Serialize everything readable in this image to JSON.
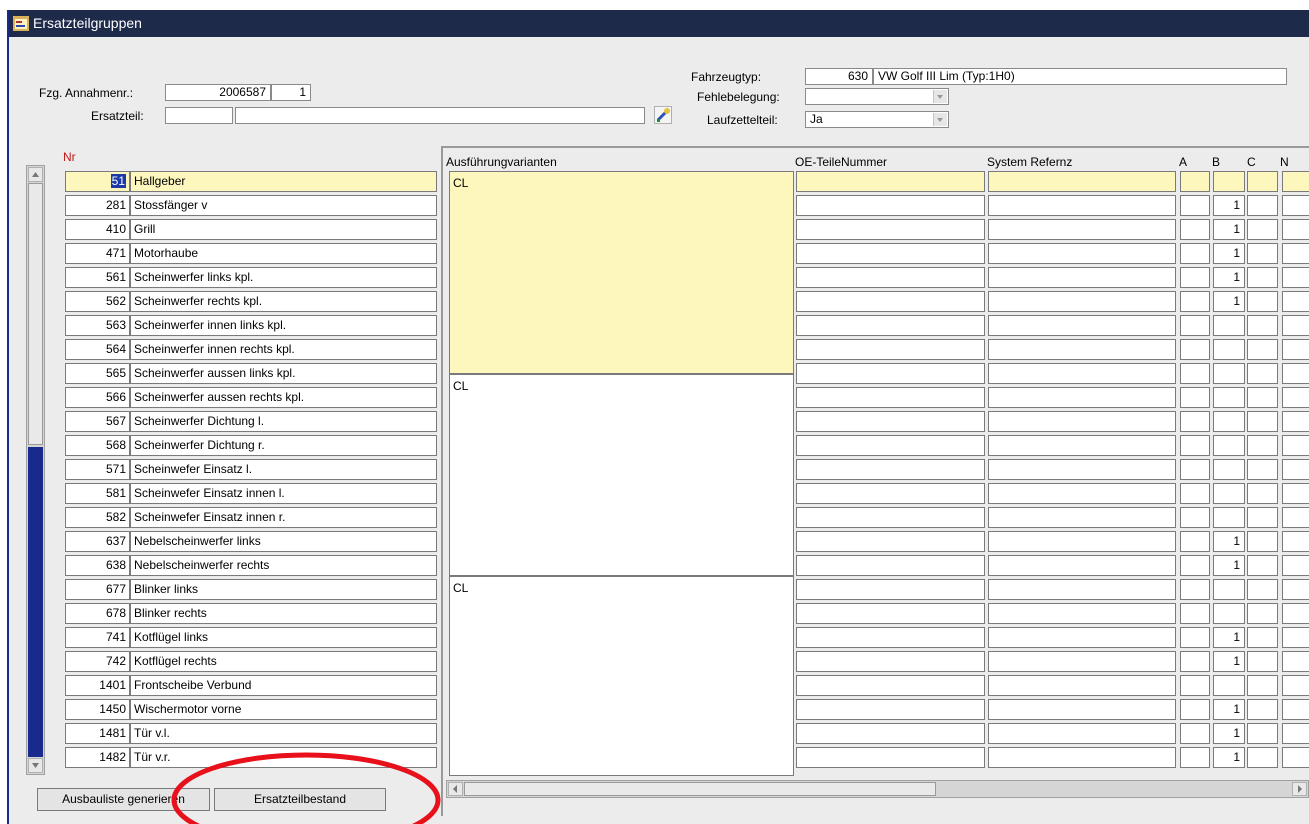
{
  "window": {
    "title": "Ersatzteilgruppen",
    "icon": "form-icon"
  },
  "form": {
    "annahme_label": "Fzg. Annahmenr.:",
    "annahme_nr": "2006587",
    "annahme_sub": "1",
    "ersatzteil_label": "Ersatzteil:",
    "ersatzteil_code": "",
    "ersatzteil_text": "",
    "fahrzeugtyp_label": "Fahrzeugtyp:",
    "fahrzeugtyp_nr": "630",
    "fahrzeugtyp_name": "VW  Golf III Lim (Typ:1H0)",
    "fehlbelegung_label": "Fehlebelegung:",
    "fehlbelegung_value": "",
    "laufzettel_label": "Laufzettelteil:",
    "laufzettel_value": "Ja"
  },
  "left_table": {
    "header": "Nr",
    "rows": [
      {
        "nr": "51",
        "name": "Hallgeber"
      },
      {
        "nr": "281",
        "name": "Stossfänger v"
      },
      {
        "nr": "410",
        "name": "Grill"
      },
      {
        "nr": "471",
        "name": "Motorhaube"
      },
      {
        "nr": "561",
        "name": "Scheinwerfer links kpl."
      },
      {
        "nr": "562",
        "name": "Scheinwerfer rechts kpl."
      },
      {
        "nr": "563",
        "name": "Scheinwerfer innen links kpl."
      },
      {
        "nr": "564",
        "name": "Scheinwerfer innen rechts kpl."
      },
      {
        "nr": "565",
        "name": "Scheinwerfer aussen links kpl."
      },
      {
        "nr": "566",
        "name": "Scheinwerfer aussen rechts kpl."
      },
      {
        "nr": "567",
        "name": "Scheinwerfer Dichtung l."
      },
      {
        "nr": "568",
        "name": "Scheinwerfer Dichtung r."
      },
      {
        "nr": "571",
        "name": "Scheinwefer Einsatz l."
      },
      {
        "nr": "581",
        "name": "Scheinwefer Einsatz innen l."
      },
      {
        "nr": "582",
        "name": "Scheinwefer Einsatz innen r."
      },
      {
        "nr": "637",
        "name": "Nebelscheinwerfer links"
      },
      {
        "nr": "638",
        "name": "Nebelscheinwerfer rechts"
      },
      {
        "nr": "677",
        "name": "Blinker links"
      },
      {
        "nr": "678",
        "name": "Blinker rechts"
      },
      {
        "nr": "741",
        "name": "Kotflügel links"
      },
      {
        "nr": "742",
        "name": "Kotflügel rechts"
      },
      {
        "nr": "1401",
        "name": "Frontscheibe Verbund"
      },
      {
        "nr": "1450",
        "name": "Wischermotor vorne"
      },
      {
        "nr": "1481",
        "name": "Tür v.l."
      },
      {
        "nr": "1482",
        "name": "Tür v.r."
      }
    ]
  },
  "right_table": {
    "headers": {
      "variants": "Ausführungvarianten",
      "oe": "OE-TeileNummer",
      "ref": "System Refernz",
      "a": "A",
      "b": "B",
      "c": "C",
      "n": "N"
    },
    "variants": [
      "CL",
      "CL",
      "CL"
    ],
    "b_values": [
      "",
      "1",
      "1",
      "1",
      "1",
      "1",
      "",
      "",
      "",
      "",
      "",
      "",
      "",
      "",
      "",
      "1",
      "1",
      "",
      "",
      "1",
      "1",
      "",
      "1",
      "1",
      "1"
    ]
  },
  "buttons": {
    "generate": "Ausbauliste generieren",
    "bestand": "Ersatzteilbestand"
  },
  "colors": {
    "titlebar": "#1e2a4a",
    "highlight": "#fdf6bd",
    "selection": "#1b3aa8",
    "annotation": "#e8101a"
  }
}
